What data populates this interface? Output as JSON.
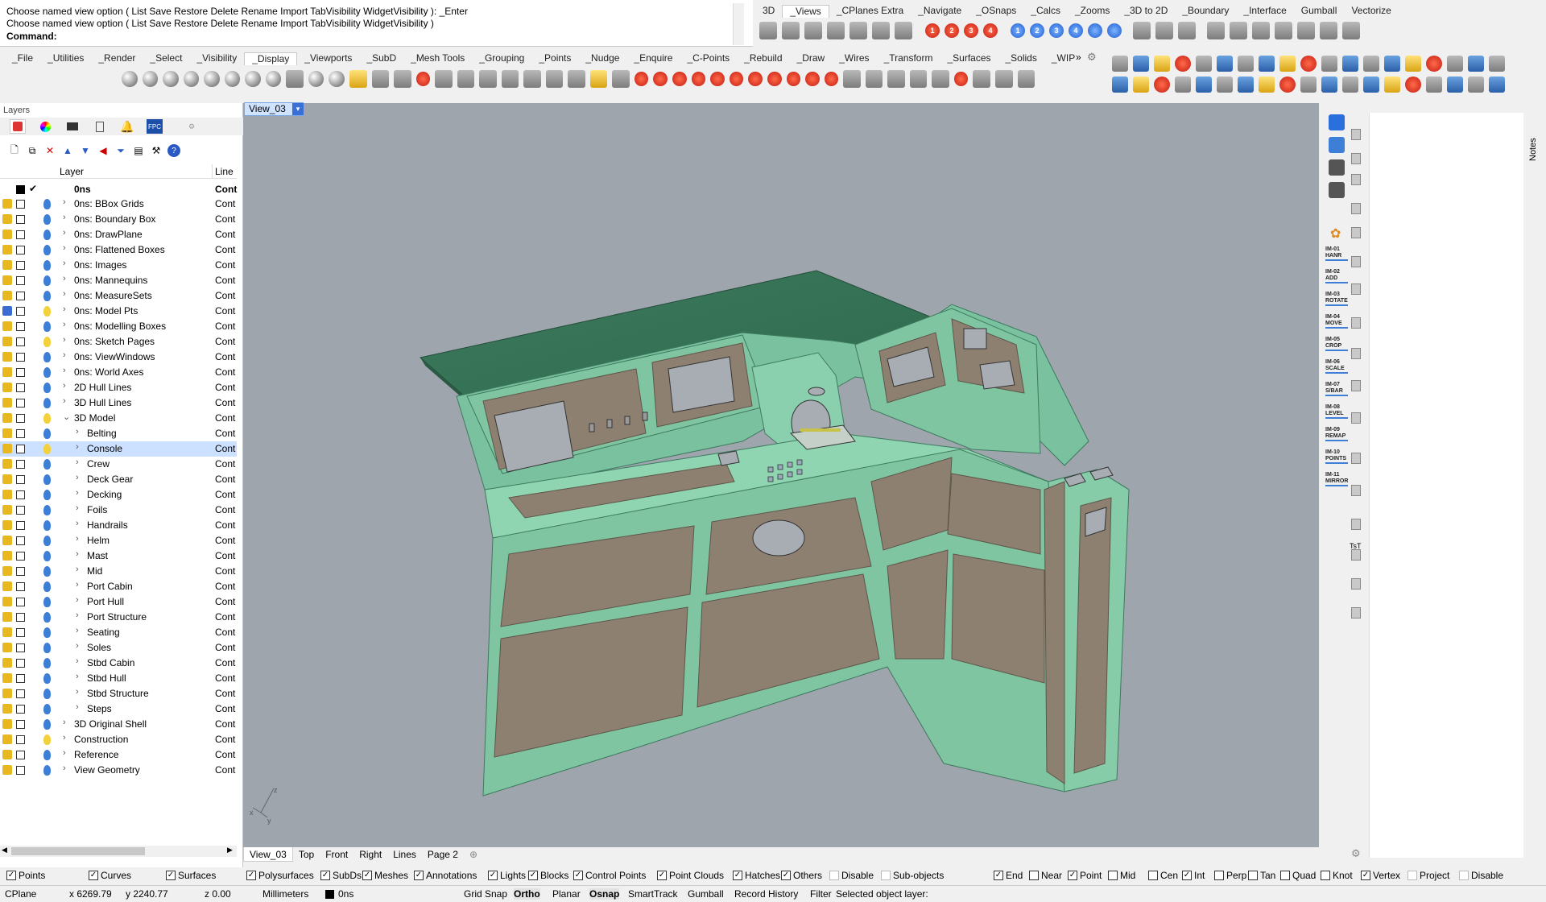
{
  "command": {
    "line1": "Choose named view option ( List  Save  Restore  Delete  Rename  Import  TabVisibility  WidgetVisibility ): _Enter",
    "line2": "Choose named view option ( List  Save  Restore  Delete  Rename  Import  TabVisibility  WidgetVisibility )",
    "prompt_label": "Command:"
  },
  "toolbar_top_tabs": [
    "3D",
    "_Views",
    "_CPlanes Extra",
    "_Navigate",
    "_OSnaps",
    "_Calcs",
    "_Zooms",
    "_3D to 2D",
    "_Boundary",
    "_Interface",
    "Gumball",
    "Vectorize"
  ],
  "toolbar_top_active": "_Views",
  "toolbar_main_tabs": [
    "_File",
    "_Utilities",
    "_Render",
    "_Select",
    "_Visibility",
    "_Display",
    "_Viewports",
    "_SubD",
    "_Mesh Tools",
    "_Grouping",
    "_Points",
    "_Nudge",
    "_Enquire",
    "_C-Points",
    "_Rebuild",
    "_Draw",
    "_Wires",
    "_Transform",
    "_Surfaces",
    "_Solids",
    "_WIP"
  ],
  "toolbar_main_active": "_Display",
  "toolbar_main_overflow": "»",
  "view_numbers_red": [
    "1",
    "2",
    "3",
    "4"
  ],
  "view_numbers_blue": [
    "1",
    "2",
    "3",
    "4"
  ],
  "layers_panel": {
    "title": "Layers",
    "col_layer": "Layer",
    "col_linetype": "Line",
    "current_layer": "0ns",
    "current_linetype": "Cont",
    "rows": [
      {
        "name": "0ns: BBox Grids",
        "indent": 1,
        "expand": true,
        "bulb": "blue",
        "linetype": "Cont"
      },
      {
        "name": "0ns: Boundary Box",
        "indent": 1,
        "expand": true,
        "bulb": "blue",
        "linetype": "Cont"
      },
      {
        "name": "0ns: DrawPlane",
        "indent": 1,
        "expand": true,
        "bulb": "blue",
        "linetype": "Cont"
      },
      {
        "name": "0ns: Flattened Boxes",
        "indent": 1,
        "expand": true,
        "bulb": "blue",
        "linetype": "Cont"
      },
      {
        "name": "0ns: Images",
        "indent": 1,
        "expand": true,
        "bulb": "blue",
        "linetype": "Cont"
      },
      {
        "name": "0ns: Mannequins",
        "indent": 1,
        "expand": true,
        "bulb": "blue",
        "linetype": "Cont"
      },
      {
        "name": "0ns: MeasureSets",
        "indent": 1,
        "expand": true,
        "bulb": "blue",
        "linetype": "Cont"
      },
      {
        "name": "0ns: Model Pts",
        "indent": 1,
        "expand": true,
        "bulb": "yellow",
        "linetype": "Cont",
        "lock": "blue"
      },
      {
        "name": "0ns: Modelling Boxes",
        "indent": 1,
        "expand": true,
        "bulb": "blue",
        "linetype": "Cont"
      },
      {
        "name": "0ns: Sketch Pages",
        "indent": 1,
        "expand": true,
        "bulb": "yellow",
        "linetype": "Cont"
      },
      {
        "name": "0ns: ViewWindows",
        "indent": 1,
        "expand": true,
        "bulb": "blue",
        "linetype": "Cont"
      },
      {
        "name": "0ns: World Axes",
        "indent": 1,
        "expand": true,
        "bulb": "blue",
        "linetype": "Cont"
      },
      {
        "name": "2D Hull Lines",
        "indent": 1,
        "expand": true,
        "bulb": "blue",
        "linetype": "Cont"
      },
      {
        "name": "3D Hull Lines",
        "indent": 1,
        "expand": true,
        "bulb": "blue",
        "linetype": "Cont"
      },
      {
        "name": "3D Model",
        "indent": 1,
        "expand": "open",
        "bulb": "yellow",
        "linetype": "Cont"
      },
      {
        "name": "Belting",
        "indent": 2,
        "expand": true,
        "bulb": "blue",
        "linetype": "Cont"
      },
      {
        "name": "Console",
        "indent": 2,
        "expand": true,
        "bulb": "yellow",
        "linetype": "Cont",
        "selected": true
      },
      {
        "name": "Crew",
        "indent": 2,
        "expand": true,
        "bulb": "blue",
        "linetype": "Cont"
      },
      {
        "name": "Deck Gear",
        "indent": 2,
        "expand": true,
        "bulb": "blue",
        "linetype": "Cont"
      },
      {
        "name": "Decking",
        "indent": 2,
        "expand": true,
        "bulb": "blue",
        "linetype": "Cont"
      },
      {
        "name": "Foils",
        "indent": 2,
        "expand": true,
        "bulb": "blue",
        "linetype": "Cont"
      },
      {
        "name": "Handrails",
        "indent": 2,
        "expand": true,
        "bulb": "blue",
        "linetype": "Cont"
      },
      {
        "name": "Helm",
        "indent": 2,
        "expand": true,
        "bulb": "blue",
        "linetype": "Cont"
      },
      {
        "name": "Mast",
        "indent": 2,
        "expand": true,
        "bulb": "blue",
        "linetype": "Cont"
      },
      {
        "name": "Mid",
        "indent": 2,
        "expand": true,
        "bulb": "blue",
        "linetype": "Cont"
      },
      {
        "name": "Port Cabin",
        "indent": 2,
        "expand": true,
        "bulb": "blue",
        "linetype": "Cont"
      },
      {
        "name": "Port Hull",
        "indent": 2,
        "expand": true,
        "bulb": "blue",
        "linetype": "Cont"
      },
      {
        "name": "Port Structure",
        "indent": 2,
        "expand": true,
        "bulb": "blue",
        "linetype": "Cont"
      },
      {
        "name": "Seating",
        "indent": 2,
        "expand": true,
        "bulb": "blue",
        "linetype": "Cont"
      },
      {
        "name": "Soles",
        "indent": 2,
        "expand": true,
        "bulb": "blue",
        "linetype": "Cont"
      },
      {
        "name": "Stbd Cabin",
        "indent": 2,
        "expand": true,
        "bulb": "blue",
        "linetype": "Cont"
      },
      {
        "name": "Stbd Hull",
        "indent": 2,
        "expand": true,
        "bulb": "blue",
        "linetype": "Cont"
      },
      {
        "name": "Stbd Structure",
        "indent": 2,
        "expand": true,
        "bulb": "blue",
        "linetype": "Cont"
      },
      {
        "name": "Steps",
        "indent": 2,
        "expand": true,
        "bulb": "blue",
        "linetype": "Cont"
      },
      {
        "name": "3D Original Shell",
        "indent": 1,
        "expand": true,
        "bulb": "blue",
        "linetype": "Cont"
      },
      {
        "name": "Construction",
        "indent": 1,
        "expand": true,
        "bulb": "yellow",
        "linetype": "Cont"
      },
      {
        "name": "Reference",
        "indent": 1,
        "expand": true,
        "bulb": "blue",
        "linetype": "Cont"
      },
      {
        "name": "View Geometry",
        "indent": 1,
        "expand": true,
        "bulb": "blue",
        "linetype": "Cont"
      }
    ]
  },
  "viewport": {
    "title": "View_03",
    "dropdown": "▾",
    "axis_z": "z",
    "axis_x": "x",
    "axis_y": "y"
  },
  "right_macros": [
    "IM-01 HANR",
    "IM-02 ADD",
    "IM-03 ROTATE",
    "IM-04 MOVE",
    "IM-05 CROP",
    "IM-06 SCALE",
    "IM-07 S/BAR",
    "IM-08 LEVEL",
    "IM-09 REMAP",
    "IM-10 POINTS",
    "IM-11 MIRROR"
  ],
  "right_tst": "TsT",
  "notes_label": "Notes",
  "view_tabs": [
    "View_03",
    "Top",
    "Front",
    "Right",
    "Lines",
    "Page 2"
  ],
  "view_tabs_active": "View_03",
  "filter_checkboxes": [
    {
      "label": "Points",
      "checked": true
    },
    {
      "label": "Curves",
      "checked": true
    },
    {
      "label": "Surfaces",
      "checked": true
    },
    {
      "label": "Polysurfaces",
      "checked": true
    },
    {
      "label": "SubDs",
      "checked": true
    },
    {
      "label": "Meshes",
      "checked": true
    },
    {
      "label": "Annotations",
      "checked": true
    },
    {
      "label": "Lights",
      "checked": true
    },
    {
      "label": "Blocks",
      "checked": true
    },
    {
      "label": "Control Points",
      "checked": true
    },
    {
      "label": "Point Clouds",
      "checked": true
    },
    {
      "label": "Hatches",
      "checked": true
    },
    {
      "label": "Others",
      "checked": true
    },
    {
      "label": "Disable",
      "checked": false,
      "dim": true
    },
    {
      "label": "Sub-objects",
      "checked": false,
      "dim": true
    }
  ],
  "osnap_checkboxes": [
    {
      "label": "End",
      "checked": true
    },
    {
      "label": "Near",
      "checked": false
    },
    {
      "label": "Point",
      "checked": true
    },
    {
      "label": "Mid",
      "checked": false
    },
    {
      "label": "Cen",
      "checked": false
    },
    {
      "label": "Int",
      "checked": true
    },
    {
      "label": "Perp",
      "checked": false
    },
    {
      "label": "Tan",
      "checked": false
    },
    {
      "label": "Quad",
      "checked": false
    },
    {
      "label": "Knot",
      "checked": false
    },
    {
      "label": "Vertex",
      "checked": true
    },
    {
      "label": "Project",
      "checked": false,
      "dim": true
    },
    {
      "label": "Disable",
      "checked": false,
      "dim": true
    }
  ],
  "status": {
    "cplane": "CPlane",
    "x": "x 6269.79",
    "y": "y 2240.77",
    "z": "z 0.00",
    "units": "Millimeters",
    "layer": "0ns",
    "grid_snap": "Grid Snap",
    "ortho": "Ortho",
    "planar": "Planar",
    "osnap": "Osnap",
    "smarttrack": "SmartTrack",
    "gumball": "Gumball",
    "record_history": "Record History",
    "filter": "Filter",
    "message": "Selected object layer:"
  },
  "colors": {
    "viewport_bg": "#9ea5ad",
    "console_green": "#7fc2a0",
    "console_dark": "#3e7a5e",
    "panel_tan": "#8e8070",
    "selection": "#cce0ff"
  }
}
